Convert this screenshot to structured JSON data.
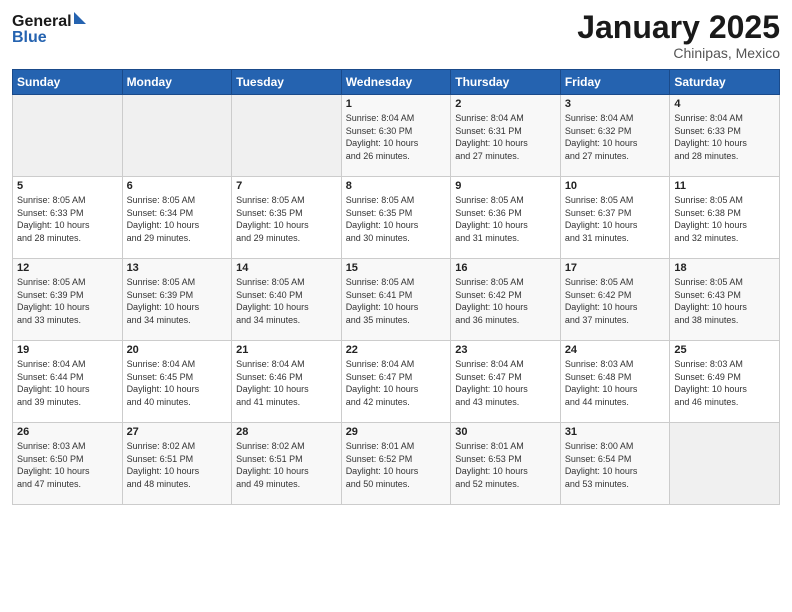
{
  "logo": {
    "line1": "General",
    "line2": "Blue"
  },
  "title": "January 2025",
  "subtitle": "Chinipas, Mexico",
  "headers": [
    "Sunday",
    "Monday",
    "Tuesday",
    "Wednesday",
    "Thursday",
    "Friday",
    "Saturday"
  ],
  "weeks": [
    [
      {
        "day": "",
        "info": ""
      },
      {
        "day": "",
        "info": ""
      },
      {
        "day": "",
        "info": ""
      },
      {
        "day": "1",
        "info": "Sunrise: 8:04 AM\nSunset: 6:30 PM\nDaylight: 10 hours\nand 26 minutes."
      },
      {
        "day": "2",
        "info": "Sunrise: 8:04 AM\nSunset: 6:31 PM\nDaylight: 10 hours\nand 27 minutes."
      },
      {
        "day": "3",
        "info": "Sunrise: 8:04 AM\nSunset: 6:32 PM\nDaylight: 10 hours\nand 27 minutes."
      },
      {
        "day": "4",
        "info": "Sunrise: 8:04 AM\nSunset: 6:33 PM\nDaylight: 10 hours\nand 28 minutes."
      }
    ],
    [
      {
        "day": "5",
        "info": "Sunrise: 8:05 AM\nSunset: 6:33 PM\nDaylight: 10 hours\nand 28 minutes."
      },
      {
        "day": "6",
        "info": "Sunrise: 8:05 AM\nSunset: 6:34 PM\nDaylight: 10 hours\nand 29 minutes."
      },
      {
        "day": "7",
        "info": "Sunrise: 8:05 AM\nSunset: 6:35 PM\nDaylight: 10 hours\nand 29 minutes."
      },
      {
        "day": "8",
        "info": "Sunrise: 8:05 AM\nSunset: 6:35 PM\nDaylight: 10 hours\nand 30 minutes."
      },
      {
        "day": "9",
        "info": "Sunrise: 8:05 AM\nSunset: 6:36 PM\nDaylight: 10 hours\nand 31 minutes."
      },
      {
        "day": "10",
        "info": "Sunrise: 8:05 AM\nSunset: 6:37 PM\nDaylight: 10 hours\nand 31 minutes."
      },
      {
        "day": "11",
        "info": "Sunrise: 8:05 AM\nSunset: 6:38 PM\nDaylight: 10 hours\nand 32 minutes."
      }
    ],
    [
      {
        "day": "12",
        "info": "Sunrise: 8:05 AM\nSunset: 6:39 PM\nDaylight: 10 hours\nand 33 minutes."
      },
      {
        "day": "13",
        "info": "Sunrise: 8:05 AM\nSunset: 6:39 PM\nDaylight: 10 hours\nand 34 minutes."
      },
      {
        "day": "14",
        "info": "Sunrise: 8:05 AM\nSunset: 6:40 PM\nDaylight: 10 hours\nand 34 minutes."
      },
      {
        "day": "15",
        "info": "Sunrise: 8:05 AM\nSunset: 6:41 PM\nDaylight: 10 hours\nand 35 minutes."
      },
      {
        "day": "16",
        "info": "Sunrise: 8:05 AM\nSunset: 6:42 PM\nDaylight: 10 hours\nand 36 minutes."
      },
      {
        "day": "17",
        "info": "Sunrise: 8:05 AM\nSunset: 6:42 PM\nDaylight: 10 hours\nand 37 minutes."
      },
      {
        "day": "18",
        "info": "Sunrise: 8:05 AM\nSunset: 6:43 PM\nDaylight: 10 hours\nand 38 minutes."
      }
    ],
    [
      {
        "day": "19",
        "info": "Sunrise: 8:04 AM\nSunset: 6:44 PM\nDaylight: 10 hours\nand 39 minutes."
      },
      {
        "day": "20",
        "info": "Sunrise: 8:04 AM\nSunset: 6:45 PM\nDaylight: 10 hours\nand 40 minutes."
      },
      {
        "day": "21",
        "info": "Sunrise: 8:04 AM\nSunset: 6:46 PM\nDaylight: 10 hours\nand 41 minutes."
      },
      {
        "day": "22",
        "info": "Sunrise: 8:04 AM\nSunset: 6:47 PM\nDaylight: 10 hours\nand 42 minutes."
      },
      {
        "day": "23",
        "info": "Sunrise: 8:04 AM\nSunset: 6:47 PM\nDaylight: 10 hours\nand 43 minutes."
      },
      {
        "day": "24",
        "info": "Sunrise: 8:03 AM\nSunset: 6:48 PM\nDaylight: 10 hours\nand 44 minutes."
      },
      {
        "day": "25",
        "info": "Sunrise: 8:03 AM\nSunset: 6:49 PM\nDaylight: 10 hours\nand 46 minutes."
      }
    ],
    [
      {
        "day": "26",
        "info": "Sunrise: 8:03 AM\nSunset: 6:50 PM\nDaylight: 10 hours\nand 47 minutes."
      },
      {
        "day": "27",
        "info": "Sunrise: 8:02 AM\nSunset: 6:51 PM\nDaylight: 10 hours\nand 48 minutes."
      },
      {
        "day": "28",
        "info": "Sunrise: 8:02 AM\nSunset: 6:51 PM\nDaylight: 10 hours\nand 49 minutes."
      },
      {
        "day": "29",
        "info": "Sunrise: 8:01 AM\nSunset: 6:52 PM\nDaylight: 10 hours\nand 50 minutes."
      },
      {
        "day": "30",
        "info": "Sunrise: 8:01 AM\nSunset: 6:53 PM\nDaylight: 10 hours\nand 52 minutes."
      },
      {
        "day": "31",
        "info": "Sunrise: 8:00 AM\nSunset: 6:54 PM\nDaylight: 10 hours\nand 53 minutes."
      },
      {
        "day": "",
        "info": ""
      }
    ]
  ]
}
